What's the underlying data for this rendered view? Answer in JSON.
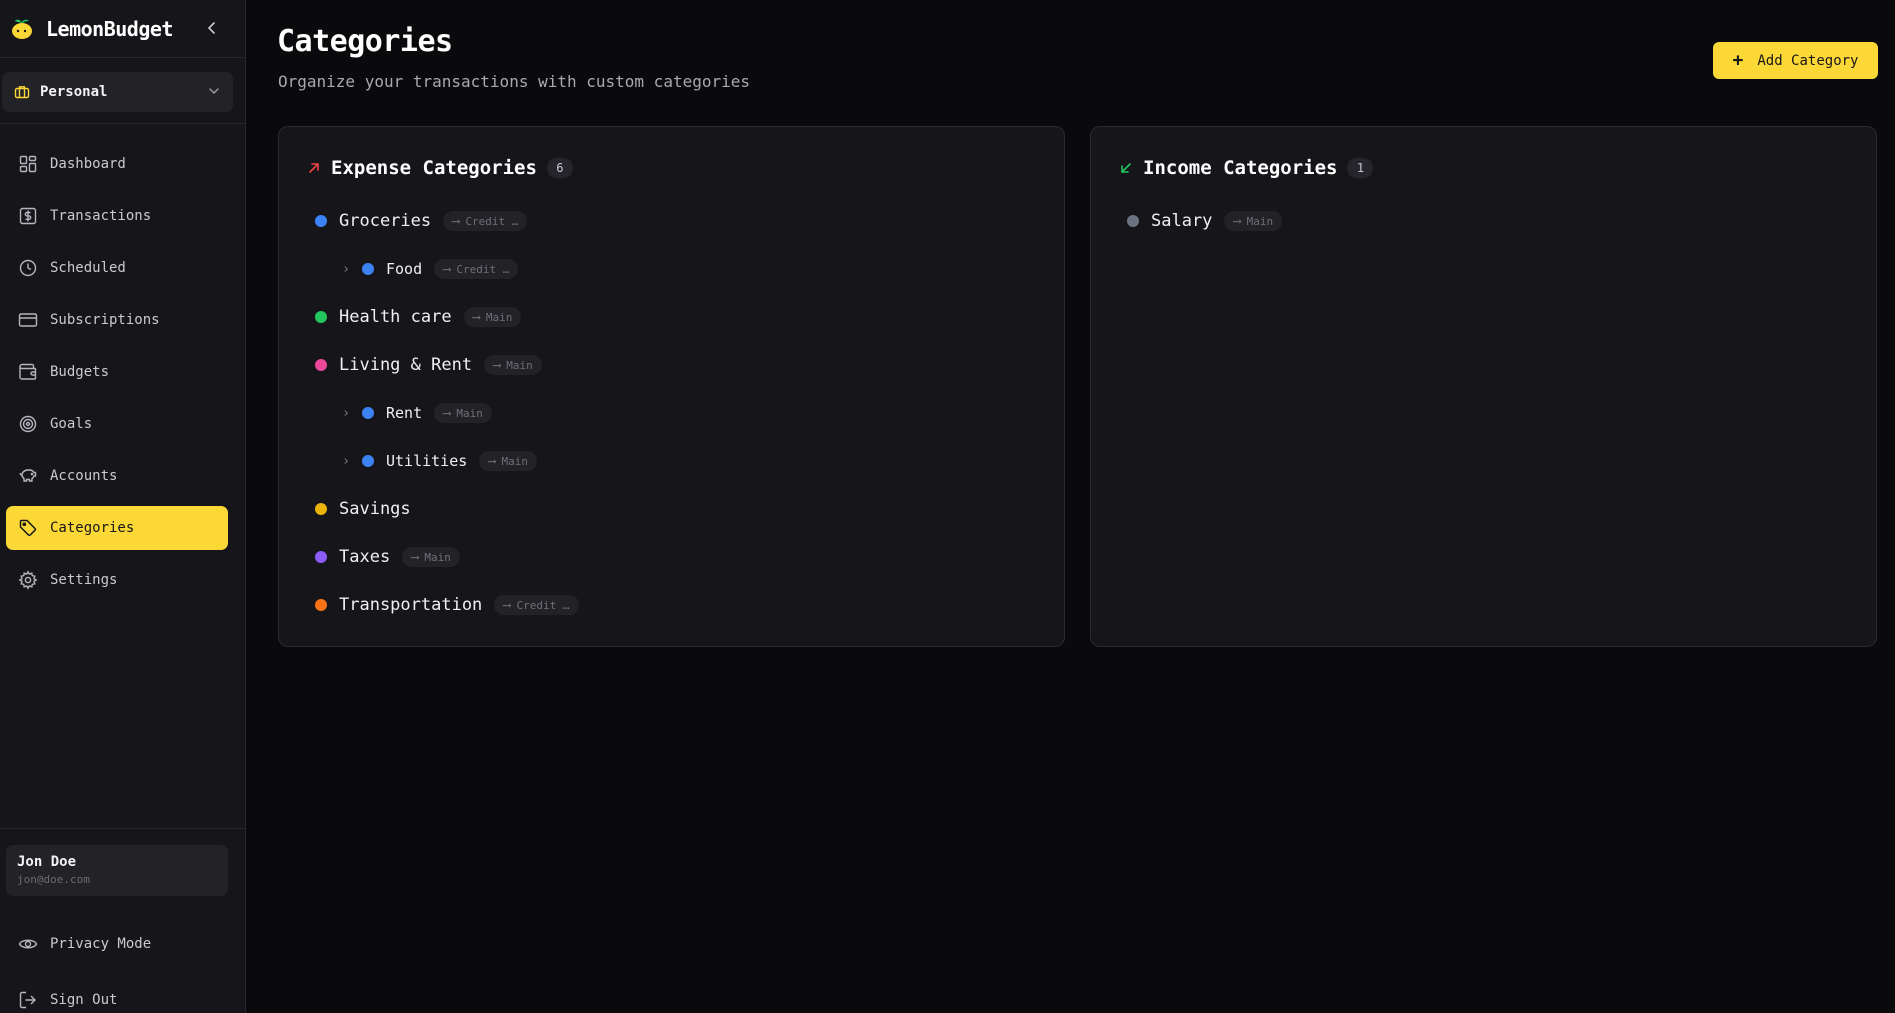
{
  "app": {
    "name": "LemonBudget"
  },
  "workspace": {
    "label": "Personal"
  },
  "nav": [
    {
      "label": "Dashboard",
      "icon": "dashboard-icon"
    },
    {
      "label": "Transactions",
      "icon": "dollar-receipt-icon"
    },
    {
      "label": "Scheduled",
      "icon": "clock-icon"
    },
    {
      "label": "Subscriptions",
      "icon": "credit-card-icon"
    },
    {
      "label": "Budgets",
      "icon": "wallet-icon"
    },
    {
      "label": "Goals",
      "icon": "target-icon"
    },
    {
      "label": "Accounts",
      "icon": "piggy-bank-icon"
    },
    {
      "label": "Categories",
      "icon": "tag-icon",
      "active": true
    },
    {
      "label": "Settings",
      "icon": "gear-icon"
    }
  ],
  "user": {
    "name": "Jon Doe",
    "email": "jon@doe.com"
  },
  "bottom_actions": {
    "privacy": "Privacy Mode",
    "signout": "Sign Out"
  },
  "page": {
    "title": "Categories",
    "subtitle": "Organize your transactions with custom categories",
    "add_button": "Add Category"
  },
  "expense": {
    "title": "Expense Categories",
    "count": "6",
    "items": [
      {
        "name": "Groceries",
        "account": "Credit …",
        "color": "#3b82f6",
        "level": 0
      },
      {
        "name": "Food",
        "account": "Credit …",
        "color": "#3b82f6",
        "level": 1
      },
      {
        "name": "Health care",
        "account": "Main",
        "color": "#22c55e",
        "level": 0
      },
      {
        "name": "Living & Rent",
        "account": "Main",
        "color": "#ec4899",
        "level": 0
      },
      {
        "name": "Rent",
        "account": "Main",
        "color": "#3b82f6",
        "level": 1
      },
      {
        "name": "Utilities",
        "account": "Main",
        "color": "#3b82f6",
        "level": 1
      },
      {
        "name": "Savings",
        "account": "",
        "color": "#eab308",
        "level": 0
      },
      {
        "name": "Taxes",
        "account": "Main",
        "color": "#8b5cf6",
        "level": 0
      },
      {
        "name": "Transportation",
        "account": "Credit …",
        "color": "#f97316",
        "level": 0
      }
    ]
  },
  "income": {
    "title": "Income Categories",
    "count": "1",
    "items": [
      {
        "name": "Salary",
        "account": "Main",
        "color": "#6b7280",
        "level": 0
      }
    ]
  },
  "colors": {
    "accent": "#fcd836",
    "expense_arrow": "#ef4444",
    "income_arrow": "#22c55e"
  }
}
